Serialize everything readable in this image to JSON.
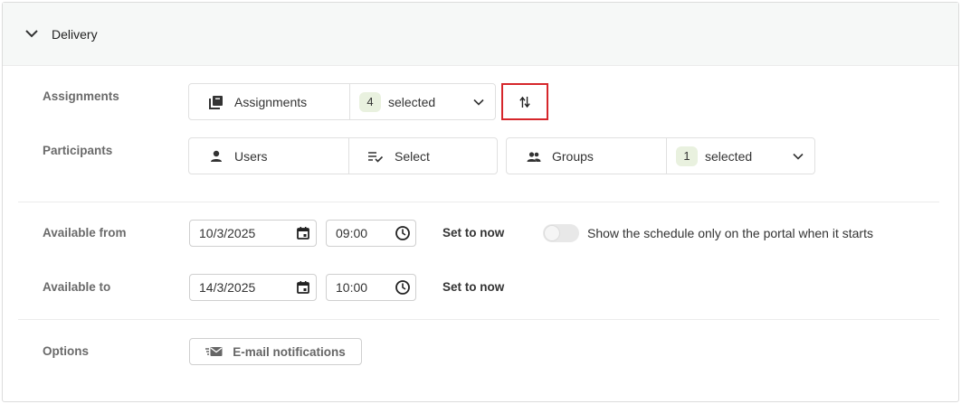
{
  "section": {
    "title": "Delivery"
  },
  "assignments": {
    "label": "Assignments",
    "type_label": "Assignments",
    "count": "4",
    "selected_text": "selected"
  },
  "participants": {
    "label": "Participants",
    "users_label": "Users",
    "users_select": "Select",
    "groups_label": "Groups",
    "groups_count": "1",
    "groups_selected_text": "selected"
  },
  "available_from": {
    "label": "Available from",
    "date": "10/3/2025",
    "time": "09:00",
    "set_now": "Set to now",
    "toggle_label": "Show the schedule only on the portal when it starts",
    "toggle_on": false
  },
  "available_to": {
    "label": "Available to",
    "date": "14/3/2025",
    "time": "10:00",
    "set_now": "Set to now"
  },
  "options": {
    "label": "Options",
    "email_button": "E-mail notifications"
  },
  "colors": {
    "header_bg": "#f6f8f7",
    "badge_bg": "#e9f1df",
    "highlight_border": "#d6262b"
  },
  "icons": {
    "collapse": "chevron-down-icon",
    "assignments": "library-books-icon",
    "caret": "chevron-down-icon",
    "swap": "swap-vertical-icon",
    "user": "person-icon",
    "select": "checklist-icon",
    "groups": "people-icon",
    "calendar": "calendar-icon",
    "clock": "clock-icon",
    "email": "email-fast-icon"
  }
}
